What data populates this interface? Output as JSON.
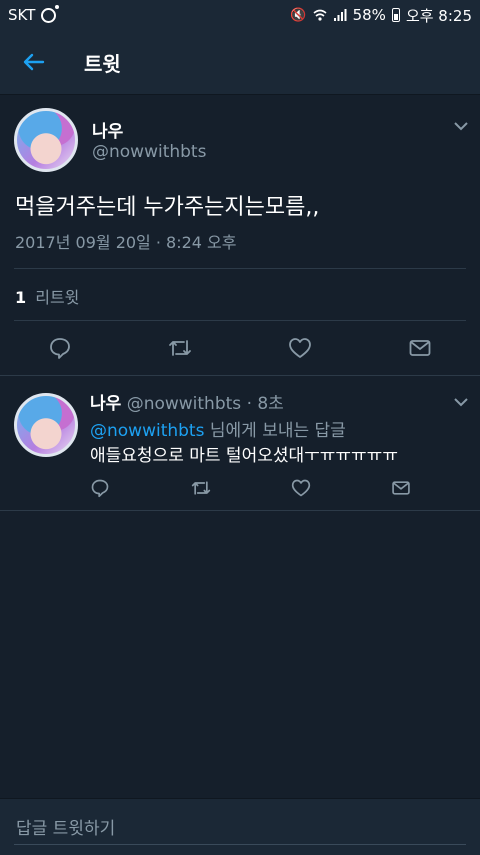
{
  "status": {
    "carrier": "SKT",
    "battery": "58%",
    "time": "오후 8:25"
  },
  "appbar": {
    "title": "트윗"
  },
  "tweet": {
    "name": "나우",
    "handle": "@nowwithbts",
    "text": "먹을거주는데 누가주는지는모름,,",
    "date": "2017년 09월 20일 · 8:24 오후",
    "retweet_count": "1",
    "retweet_label": "리트윗"
  },
  "reply": {
    "name": "나우",
    "handle": "@nowwithbts",
    "time": "· 8초",
    "mention": "@nowwithbts",
    "reply_suffix": " 님에게 보내는 답글",
    "text": "애들요청으로 마트 털어오셨대ㅜㅠㅠㅠㅠㅠ"
  },
  "compose": {
    "placeholder": "답글 트윗하기"
  },
  "colors": {
    "background": "#151f2b",
    "bar": "#1b2836",
    "accent": "#1da1f2",
    "muted": "#8899a6"
  },
  "icons": [
    "back-arrow-icon",
    "chevron-down-icon",
    "reply-icon",
    "retweet-icon",
    "like-icon",
    "dm-icon"
  ]
}
